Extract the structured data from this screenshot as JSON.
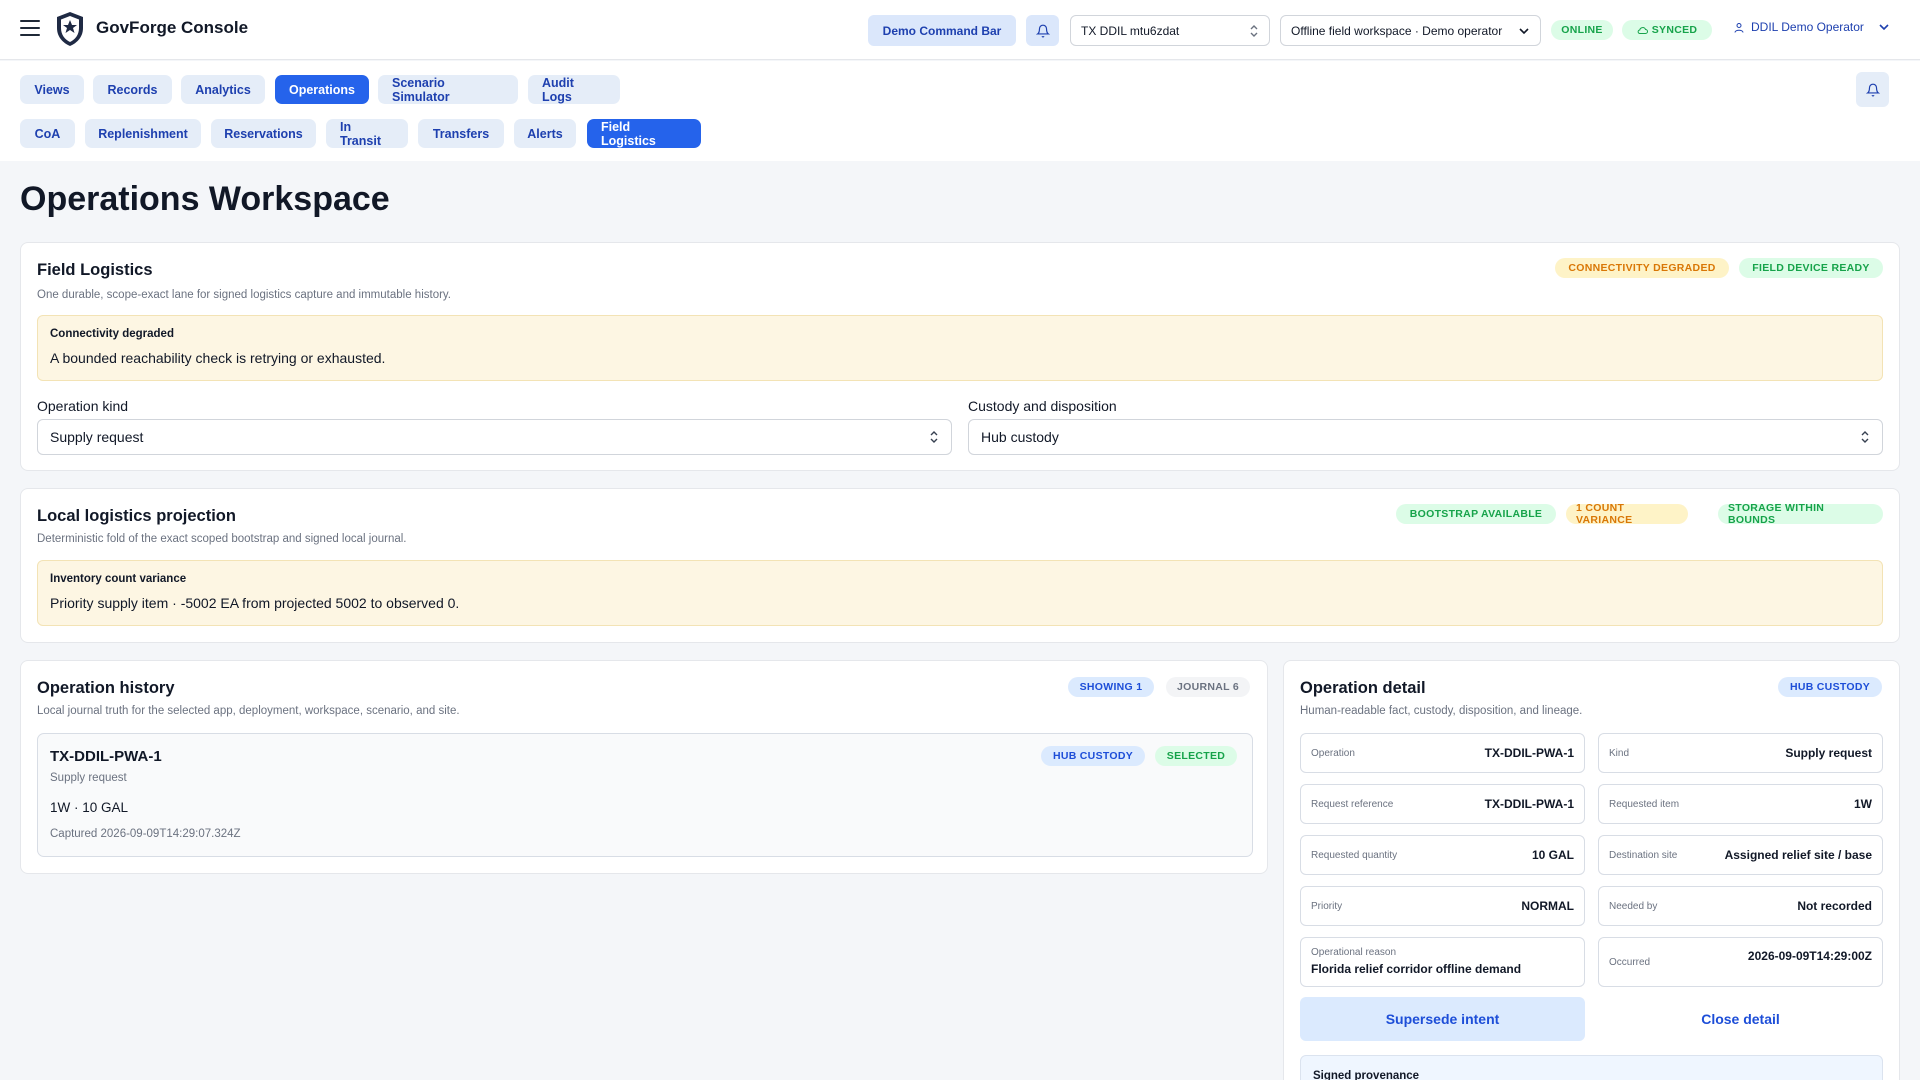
{
  "app": {
    "title": "GovForge Console"
  },
  "topbar": {
    "command_bar_label": "Demo Command Bar",
    "tenant_select": "TX DDIL mtu6zdat",
    "workspace_select": "Offline field workspace · Demo operator",
    "status_online": "ONLINE",
    "status_synced": "SYNCED",
    "user_name": "DDIL Demo Operator"
  },
  "nav": {
    "primary_tabs": [
      {
        "label": "Views"
      },
      {
        "label": "Records"
      },
      {
        "label": "Analytics"
      },
      {
        "label": "Operations"
      },
      {
        "label": "Scenario Simulator"
      },
      {
        "label": "Audit Logs"
      }
    ],
    "primary_active": "Operations",
    "secondary_tabs": [
      {
        "label": "CoA"
      },
      {
        "label": "Replenishment"
      },
      {
        "label": "Reservations"
      },
      {
        "label": "In Transit"
      },
      {
        "label": "Transfers"
      },
      {
        "label": "Alerts"
      },
      {
        "label": "Field Logistics"
      }
    ],
    "secondary_active": "Field Logistics"
  },
  "page": {
    "title": "Operations Workspace"
  },
  "field_logistics": {
    "title": "Field Logistics",
    "subtitle": "One durable, scope-exact lane for signed logistics capture and immutable history.",
    "badges": [
      "CONNECTIVITY DEGRADED",
      "FIELD DEVICE READY"
    ],
    "notice_title": "Connectivity degraded",
    "notice_body": "A bounded reachability check is retrying or exhausted.",
    "operation_kind_label": "Operation kind",
    "operation_kind_value": "Supply request",
    "custody_label": "Custody and disposition",
    "custody_value": "Hub custody"
  },
  "projection": {
    "title": "Local logistics projection",
    "subtitle": "Deterministic fold of the exact scoped bootstrap and signed local journal.",
    "badges": [
      "BOOTSTRAP AVAILABLE",
      "1 COUNT VARIANCE",
      "STORAGE WITHIN BOUNDS"
    ],
    "notice_title": "Inventory count variance",
    "notice_body": "Priority supply item · -5002 EA from projected 5002 to observed 0."
  },
  "history": {
    "title": "Operation history",
    "subtitle": "Local journal truth for the selected app, deployment, workspace, scenario, and site.",
    "badges": [
      "SHOWING 1",
      "JOURNAL 6"
    ],
    "item": {
      "id": "TX-DDIL-PWA-1",
      "kind": "Supply request",
      "badges": [
        "HUB CUSTODY",
        "SELECTED"
      ],
      "summary": "1W · 10 GAL",
      "captured": "Captured 2026-09-09T14:29:07.324Z"
    }
  },
  "detail": {
    "title": "Operation detail",
    "subtitle": "Human-readable fact, custody, disposition, and lineage.",
    "badge": "HUB CUSTODY",
    "fields": [
      {
        "k": "Operation",
        "v": "TX-DDIL-PWA-1"
      },
      {
        "k": "Kind",
        "v": "Supply request"
      },
      {
        "k": "Request reference",
        "v": "TX-DDIL-PWA-1"
      },
      {
        "k": "Requested item",
        "v": "1W"
      },
      {
        "k": "Requested quantity",
        "v": "10 GAL"
      },
      {
        "k": "Destination site",
        "v": "Assigned relief site / base"
      },
      {
        "k": "Priority",
        "v": "NORMAL"
      },
      {
        "k": "Needed by",
        "v": "Not recorded"
      },
      {
        "k": "Operational reason",
        "v": "Florida relief corridor offline demand"
      },
      {
        "k": "Occurred",
        "v": "2026-09-09T14:29:00Z"
      }
    ],
    "supersede_label": "Supersede intent",
    "close_label": "Close detail",
    "provenance_label": "Signed provenance"
  },
  "colors": {
    "accent": "#2563eb",
    "warning_bg": "#fdf6e3",
    "success": "#16a34a",
    "warning": "#d97706"
  },
  "icons": [
    "menu-icon",
    "shield-logo-icon",
    "bell-icon",
    "chevron-updown-icon",
    "chevron-down-icon",
    "cloud-icon",
    "user-icon"
  ]
}
